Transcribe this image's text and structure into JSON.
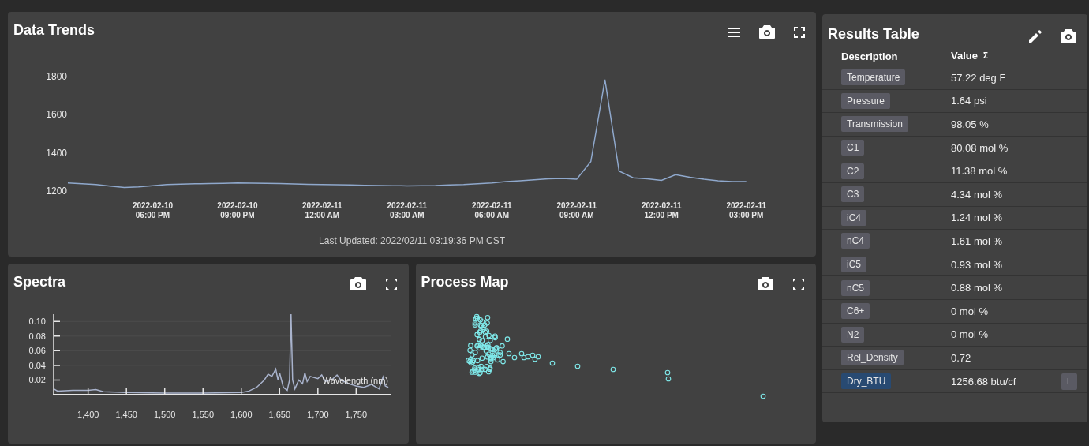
{
  "data_trends": {
    "title": "Data Trends",
    "chart_data": {
      "type": "line",
      "categories": [
        null,
        null,
        null,
        null,
        null,
        null,
        "2022-02-10 06:00 PM",
        null,
        null,
        null,
        null,
        null,
        "2022-02-10 09:00 PM",
        null,
        null,
        null,
        null,
        null,
        "2022-02-11 12:00 AM",
        null,
        null,
        null,
        null,
        null,
        "2022-02-11 03:00 AM",
        null,
        null,
        null,
        null,
        null,
        "2022-02-11 06:00 AM",
        null,
        null,
        null,
        null,
        null,
        "2022-02-11 09:00 AM",
        null,
        null,
        null,
        null,
        null,
        "2022-02-11 12:00 PM",
        null,
        null,
        null,
        null,
        null,
        "2022-02-11 03:00 PM"
      ],
      "series": [
        {
          "color": "#8fa8cc",
          "values": [
            1238,
            1234,
            1230,
            1222,
            1215,
            1218,
            1224,
            1230,
            1232,
            1234,
            1235,
            1236,
            1238,
            1237,
            1236,
            1235,
            1233,
            1231,
            1230,
            1229,
            1228,
            1226,
            1225,
            1224,
            1223,
            1224,
            1225,
            1228,
            1230,
            1234,
            1238,
            1245,
            1250,
            1255,
            1260,
            1262,
            1258,
            1350,
            1780,
            1300,
            1265,
            1260,
            1252,
            1282,
            1268,
            1258,
            1250,
            1245,
            1245
          ]
        }
      ],
      "ylim": [
        1200,
        1800
      ],
      "yticks": [
        1200,
        1400,
        1600,
        1800
      ]
    },
    "last_updated": "Last Updated: 2022/02/11 03:19:36 PM CST"
  },
  "spectra": {
    "title": "Spectra",
    "chart_data": {
      "type": "line",
      "xlabel": "Wavelength (nm)",
      "x": [
        1355,
        1360,
        1380,
        1400,
        1410,
        1420,
        1450,
        1500,
        1550,
        1600,
        1610,
        1620,
        1630,
        1635,
        1640,
        1645,
        1648,
        1650,
        1655,
        1660,
        1663,
        1665,
        1667,
        1670,
        1675,
        1680,
        1683,
        1686,
        1690,
        1700,
        1705,
        1710,
        1720,
        1725,
        1730,
        1740,
        1750,
        1760,
        1770,
        1780,
        1785,
        1788,
        1792
      ],
      "grid": true,
      "series": [
        {
          "color": "#a9b3cc",
          "values": [
            0.008,
            0.005,
            0.006,
            0.006,
            0.007,
            0.004,
            0.003,
            0.002,
            0.002,
            0.003,
            0.005,
            0.01,
            0.02,
            0.028,
            0.025,
            0.035,
            0.02,
            0.03,
            0.01,
            0.006,
            0.02,
            0.11,
            0.02,
            0.008,
            0.02,
            0.015,
            0.03,
            0.018,
            0.025,
            0.022,
            0.027,
            0.018,
            0.022,
            0.027,
            0.02,
            0.015,
            0.012,
            0.01,
            0.014,
            0.008,
            0.024,
            0.012,
            0.01
          ]
        }
      ],
      "xlim": [
        1355,
        1795
      ],
      "ylim": [
        0,
        0.11
      ],
      "xticks": [
        {
          "value": 1400,
          "label": "1,400"
        },
        {
          "value": 1450,
          "label": "1,450"
        },
        {
          "value": 1500,
          "label": "1,500"
        },
        {
          "value": 1550,
          "label": "1,550"
        },
        {
          "value": 1600,
          "label": "1,600"
        },
        {
          "value": 1650,
          "label": "1,650"
        },
        {
          "value": 1700,
          "label": "1,700"
        },
        {
          "value": 1750,
          "label": "1,750"
        }
      ],
      "yticks": [
        {
          "value": 0.02,
          "label": "0.02"
        },
        {
          "value": 0.04,
          "label": "0.04"
        },
        {
          "value": 0.06,
          "label": "0.06"
        },
        {
          "value": 0.08,
          "label": "0.08"
        },
        {
          "value": 0.1,
          "label": "0.10"
        }
      ]
    }
  },
  "process_map": {
    "title": "Process Map"
  },
  "results_table": {
    "title": "Results Table",
    "columns": [
      {
        "label": "Description"
      },
      {
        "label": "Value",
        "symbol": "Σ"
      }
    ],
    "rows": [
      {
        "description": "Temperature",
        "value": "57.22 deg F",
        "selected": false
      },
      {
        "description": "Pressure",
        "value": "1.64 psi",
        "selected": false
      },
      {
        "description": "Transmission",
        "value": "98.05 %",
        "selected": false
      },
      {
        "description": "C1",
        "value": "80.08 mol %",
        "selected": false
      },
      {
        "description": "C2",
        "value": "11.38 mol %",
        "selected": false
      },
      {
        "description": "C3",
        "value": "4.34 mol %",
        "selected": false
      },
      {
        "description": "iC4",
        "value": "1.24 mol %",
        "selected": false
      },
      {
        "description": "nC4",
        "value": "1.61 mol %",
        "selected": false
      },
      {
        "description": "iC5",
        "value": "0.93 mol %",
        "selected": false
      },
      {
        "description": "nC5",
        "value": "0.88 mol %",
        "selected": false
      },
      {
        "description": "C6+",
        "value": "0 mol %",
        "selected": false
      },
      {
        "description": "N2",
        "value": "0 mol %",
        "selected": false
      },
      {
        "description": "Rel_Density",
        "value": "0.72",
        "selected": false
      },
      {
        "description": "Dry_BTU",
        "value": "1256.68 btu/cf",
        "selected": true,
        "flag": "L"
      }
    ]
  }
}
